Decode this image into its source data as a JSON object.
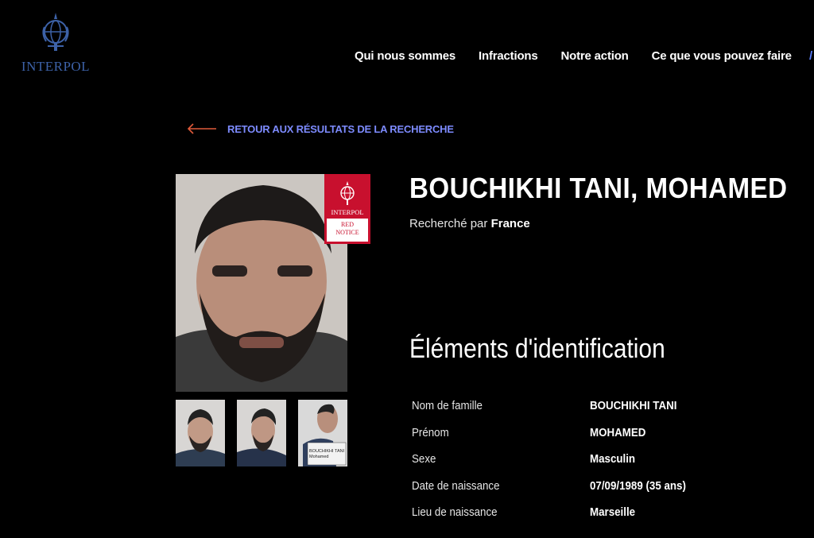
{
  "header": {
    "logo_text": "INTERPOL",
    "nav": [
      "Qui nous sommes",
      "Infractions",
      "Notre action",
      "Ce que vous pouvez faire"
    ]
  },
  "back_link": {
    "label": "RETOUR AUX RÉSULTATS DE LA RECHERCHE"
  },
  "notice": {
    "name": "BOUCHIKHI TANI, MOHAMED",
    "wanted_prefix": "Recherché par",
    "wanted_country": "France",
    "badge_org": "INTERPOL",
    "badge_type_line1": "RED",
    "badge_type_line2": "NOTICE"
  },
  "identification": {
    "title": "Éléments d'identification",
    "fields": [
      {
        "key": "Nom de famille",
        "value": "BOUCHIKHI TANI"
      },
      {
        "key": "Prénom",
        "value": "MOHAMED"
      },
      {
        "key": "Sexe",
        "value": "Masculin"
      },
      {
        "key": "Date de naissance",
        "value": "07/09/1989 (35 ans)"
      },
      {
        "key": "Lieu de naissance",
        "value": "Marseille"
      }
    ]
  },
  "thumbnails": {
    "placard_line1": "BOUCHIKHI TANI",
    "placard_line2": "Mohamed"
  },
  "colors": {
    "background": "#000000",
    "link": "#7d8bff",
    "arrow": "#e05a3a",
    "badge": "#c8102e",
    "logo": "#3d62a8"
  }
}
